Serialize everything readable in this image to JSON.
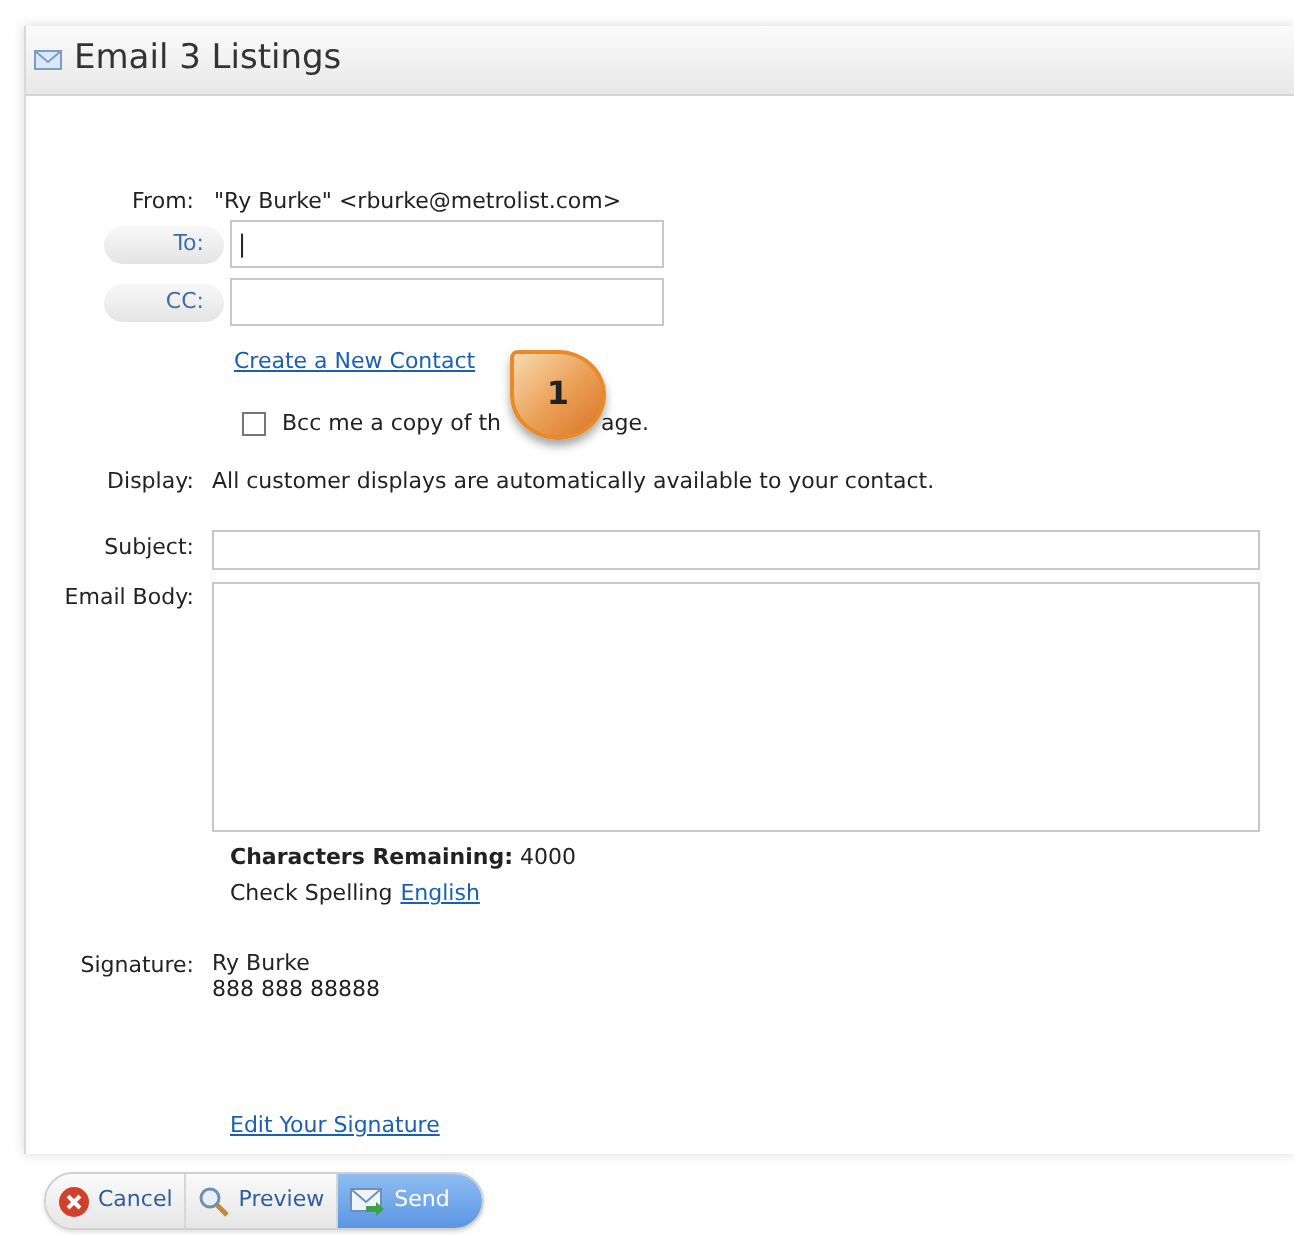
{
  "window": {
    "title": "Email 3 Listings"
  },
  "from": {
    "label": "From:",
    "value": "\"Ry Burke\" <rburke@metrolist.com>"
  },
  "recipients": [
    {
      "button": "To:",
      "value": "|"
    },
    {
      "button": "CC:"
    }
  ],
  "create_contact_link": "Create a New Contact",
  "bcc": {
    "checked": false,
    "label_before": "Bcc me a copy of th",
    "label_after": "age."
  },
  "callout": {
    "number": "1"
  },
  "display": {
    "label": "Display:",
    "value": "All customer displays are automatically available to your contact."
  },
  "subject": {
    "label": "Subject:"
  },
  "body": {
    "label": "Email Body:"
  },
  "characters_remaining": {
    "label": "Characters Remaining:",
    "value": "4000"
  },
  "spelling": {
    "label": "Check Spelling",
    "link": "English"
  },
  "signature": {
    "label": "Signature:",
    "lines": [
      "Ry Burke",
      "888 888 88888"
    ],
    "edit_link": "Edit Your Signature"
  },
  "buttons": [
    {
      "kind": "cancel",
      "label": "Cancel"
    },
    {
      "kind": "preview",
      "label": "Preview"
    },
    {
      "kind": "send",
      "label": "Send"
    }
  ]
}
